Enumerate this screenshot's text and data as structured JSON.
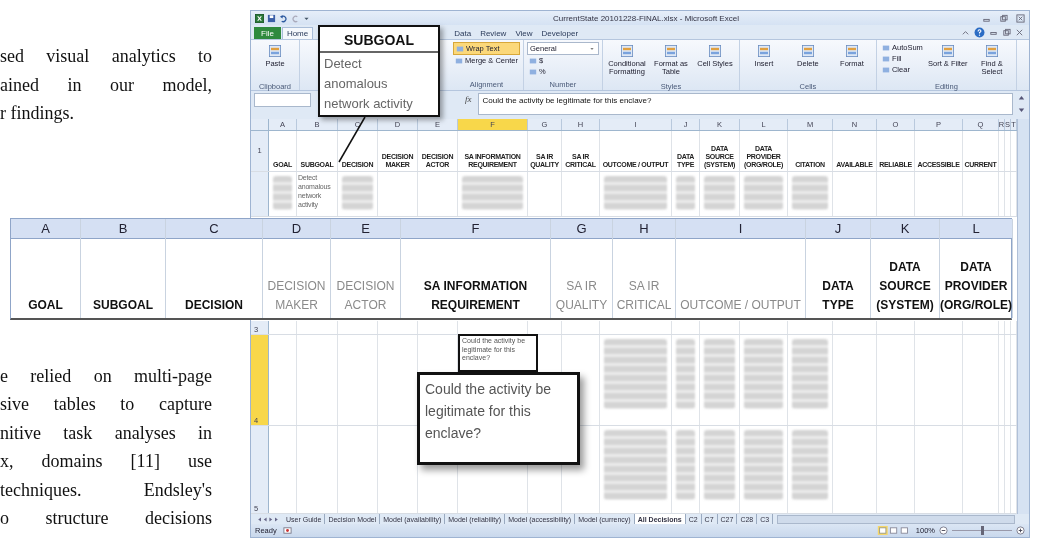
{
  "paper_text": {
    "top_lines": [
      "sed visual analytics to",
      "ained in our model,",
      "r findings."
    ],
    "bottom_lines": [
      "e relied on multi-page",
      "sive tables to capture",
      "nitive task analyses in",
      "x, domains [11] use",
      "techniques. Endsley's",
      "o structure decisions"
    ]
  },
  "window": {
    "title": "CurrentState 20101228-FINAL.xlsx - Microsoft Excel"
  },
  "ribbon_tabs": [
    {
      "label": "File",
      "kind": "file",
      "selected": false
    },
    {
      "label": "Home",
      "kind": "tab",
      "selected": true
    },
    {
      "label": "Data",
      "kind": "tab",
      "selected": false
    },
    {
      "label": "Review",
      "kind": "tab",
      "selected": false
    },
    {
      "label": "View",
      "kind": "tab",
      "selected": false
    },
    {
      "label": "Developer",
      "kind": "tab",
      "selected": false
    }
  ],
  "ribbon_groups": [
    {
      "label": "Clipboard",
      "items": [
        {
          "kind": "large",
          "label": "Paste",
          "on": false
        }
      ]
    },
    {
      "label": "Alignment",
      "items": [
        {
          "kind": "small",
          "label": "Wrap Text",
          "on": true
        },
        {
          "kind": "small",
          "label": "Merge & Center",
          "on": false
        }
      ]
    },
    {
      "label": "Number",
      "items": [
        {
          "kind": "dropdown",
          "label": "General",
          "on": false
        },
        {
          "kind": "small",
          "label": "$",
          "on": false
        },
        {
          "kind": "small",
          "label": "%",
          "on": false
        }
      ]
    },
    {
      "label": "Styles",
      "items": [
        {
          "kind": "large",
          "label": "Conditional Formatting",
          "on": false
        },
        {
          "kind": "large",
          "label": "Format as Table",
          "on": false
        },
        {
          "kind": "large",
          "label": "Cell Styles",
          "on": false
        }
      ]
    },
    {
      "label": "Cells",
      "items": [
        {
          "kind": "large",
          "label": "Insert",
          "on": false
        },
        {
          "kind": "large",
          "label": "Delete",
          "on": false
        },
        {
          "kind": "large",
          "label": "Format",
          "on": false
        }
      ]
    },
    {
      "label": "Editing",
      "items": [
        {
          "kind": "small",
          "label": "AutoSum",
          "on": false
        },
        {
          "kind": "small",
          "label": "Fill",
          "on": false
        },
        {
          "kind": "small",
          "label": "Clear",
          "on": false
        },
        {
          "kind": "large",
          "label": "Sort & Filter",
          "on": false
        },
        {
          "kind": "large",
          "label": "Find & Select",
          "on": false
        }
      ]
    }
  ],
  "formula_label": "fx",
  "formula": "Could the activity be legitimate for this enclave?",
  "sheet": {
    "columns": [
      {
        "letter": "A",
        "header": [
          "GOAL"
        ]
      },
      {
        "letter": "B",
        "header": [
          "SUBGOAL"
        ]
      },
      {
        "letter": "C",
        "header": [
          "DECISION"
        ]
      },
      {
        "letter": "D",
        "header": [
          "DECISION",
          "MAKER"
        ]
      },
      {
        "letter": "E",
        "header": [
          "DECISION",
          "ACTOR"
        ]
      },
      {
        "letter": "F",
        "header": [
          "SA INFORMATION",
          "REQUIREMENT"
        ]
      },
      {
        "letter": "G",
        "header": [
          "SA IR",
          "QUALITY"
        ]
      },
      {
        "letter": "H",
        "header": [
          "SA IR",
          "CRITICAL"
        ]
      },
      {
        "letter": "I",
        "header": [
          "OUTCOME / OUTPUT"
        ]
      },
      {
        "letter": "J",
        "header": [
          "DATA",
          "TYPE"
        ]
      },
      {
        "letter": "K",
        "header": [
          "DATA",
          "SOURCE",
          "(SYSTEM)"
        ]
      },
      {
        "letter": "L",
        "header": [
          "DATA",
          "PROVIDER",
          "(ORG/ROLE)"
        ]
      },
      {
        "letter": "M",
        "header": [
          "CITATION"
        ]
      },
      {
        "letter": "N",
        "header": [
          "AVAILABLE"
        ]
      },
      {
        "letter": "O",
        "header": [
          "RELIABLE"
        ]
      },
      {
        "letter": "P",
        "header": [
          "ACCESSIBLE"
        ]
      },
      {
        "letter": "Q",
        "header": [
          "CURRENT"
        ]
      },
      {
        "letter": "R"
      },
      {
        "letter": "S"
      },
      {
        "letter": "T"
      }
    ],
    "header_row": "1",
    "subgoal_cell": "Detect anomalous network activity",
    "lower_rows": [
      {
        "number": "3",
        "selected": false
      },
      {
        "number": "4",
        "selected": true
      },
      {
        "number": "5",
        "selected": false
      }
    ],
    "cell_note": "Could the activity be legitimate for this enclave?"
  },
  "sheet_tabs": [
    {
      "label": "User Guide",
      "selected": false
    },
    {
      "label": "Decision Model",
      "selected": false
    },
    {
      "label": "Model (availability)",
      "selected": false
    },
    {
      "label": "Model (reliability)",
      "selected": false
    },
    {
      "label": "Model (accessibility)",
      "selected": false
    },
    {
      "label": "Model (currency)",
      "selected": false
    },
    {
      "label": "All Decisions",
      "selected": true
    },
    {
      "label": "C2",
      "selected": false
    },
    {
      "label": "C7",
      "selected": false
    },
    {
      "label": "C27",
      "selected": false
    },
    {
      "label": "C28",
      "selected": false
    },
    {
      "label": "C3",
      "selected": false
    }
  ],
  "status": {
    "text": "Ready",
    "zoom": "100%",
    "zoom_slider": {
      "level": 0.5
    }
  },
  "subgoal_callout": {
    "title": "SUBGOAL",
    "lines": [
      "Detect",
      "anomalous",
      "network activity"
    ]
  },
  "zoom_callout": {
    "text": "Could the activity be legitimate for this enclave?"
  },
  "header_zoom": {
    "columns": [
      {
        "letter": "A",
        "lines": [
          "GOAL"
        ],
        "muted": false
      },
      {
        "letter": "B",
        "lines": [
          "SUBGOAL"
        ],
        "muted": false
      },
      {
        "letter": "C",
        "lines": [
          "DECISION"
        ],
        "muted": false
      },
      {
        "letter": "D",
        "lines": [
          "DECISION",
          "MAKER"
        ],
        "muted": true
      },
      {
        "letter": "E",
        "lines": [
          "DECISION",
          "ACTOR"
        ],
        "muted": true
      },
      {
        "letter": "F",
        "lines": [
          "SA INFORMATION",
          "REQUIREMENT"
        ],
        "muted": false
      },
      {
        "letter": "G",
        "lines": [
          "SA IR",
          "QUALITY"
        ],
        "muted": true
      },
      {
        "letter": "H",
        "lines": [
          "SA IR",
          "CRITICAL"
        ],
        "muted": true
      },
      {
        "letter": "I",
        "lines": [
          "OUTCOME / OUTPUT"
        ],
        "muted": true
      },
      {
        "letter": "J",
        "lines": [
          "DATA",
          "TYPE"
        ],
        "muted": false
      },
      {
        "letter": "K",
        "lines": [
          "DATA",
          "SOURCE",
          "(SYSTEM)"
        ],
        "muted": false
      },
      {
        "letter": "L",
        "lines": [
          "DATA",
          "PROVIDER",
          "(ORG/ROLE)"
        ],
        "muted": false
      }
    ]
  }
}
